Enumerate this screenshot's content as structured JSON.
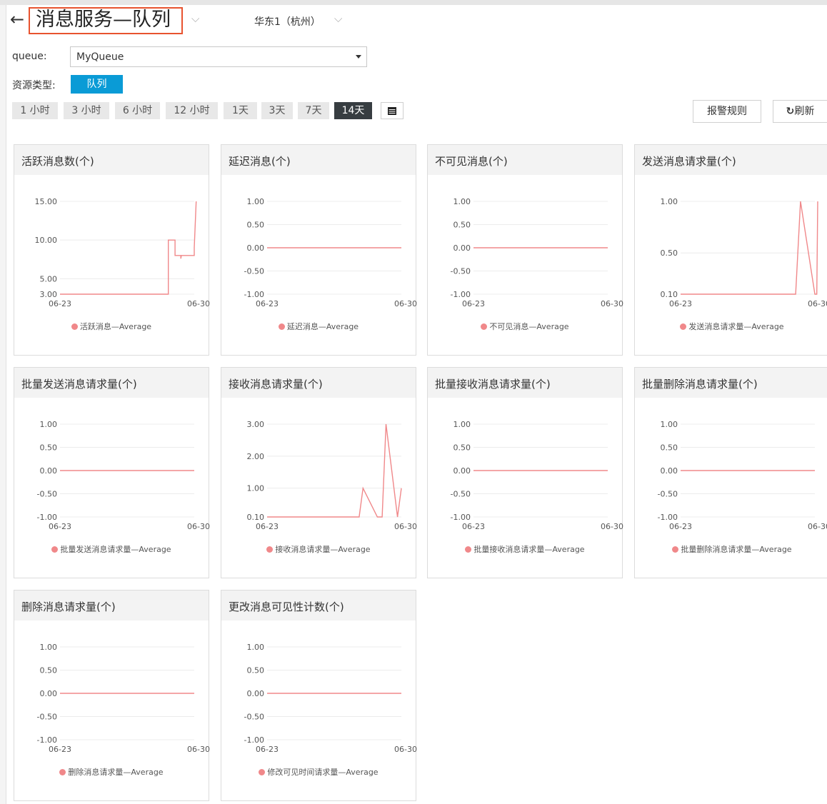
{
  "header": {
    "back_icon": "arrow-left-icon",
    "title": "消息服务—队列",
    "region": "华东1（杭州）"
  },
  "filters": {
    "queue_label": "queue:",
    "queue_value": "MyQueue",
    "resource_type_label": "资源类型:",
    "resource_type_value": "队列"
  },
  "time_ranges": [
    "1 小时",
    "3 小时",
    "6 小时",
    "12 小时",
    "1天",
    "3天",
    "7天",
    "14天"
  ],
  "active_range": "14天",
  "buttons": {
    "alarm_rules": "报警规则",
    "refresh": "刷新",
    "refresh_icon": "refresh-icon",
    "calendar_icon": "calendar-icon"
  },
  "colors": {
    "accent": "#0a9bd6",
    "series": "#f0888a",
    "title_highlight": "#e8532f",
    "active_range": "#373d41"
  },
  "chart_data": [
    {
      "type": "line",
      "title": "活跃消息数(个)",
      "yticks": [
        "15.00",
        "10.00",
        "5.00",
        "3.00"
      ],
      "ylim": [
        3,
        15
      ],
      "x_labels": [
        "06-23",
        "06-30"
      ],
      "xlim": [
        0,
        14
      ],
      "series": [
        {
          "name": "活跃消息—Average",
          "points": [
            [
              0,
              3
            ],
            [
              11.3,
              3
            ],
            [
              11.3,
              10
            ],
            [
              12,
              10
            ],
            [
              12,
              8
            ],
            [
              12.6,
              8
            ],
            [
              12.6,
              7.6
            ],
            [
              12.65,
              8
            ],
            [
              14,
              8
            ],
            [
              14,
              9
            ],
            [
              14.2,
              15
            ]
          ]
        }
      ]
    },
    {
      "type": "line",
      "title": "延迟消息(个)",
      "yticks": [
        "1.00",
        "0.50",
        "0.00",
        "-0.50",
        "-1.00"
      ],
      "ylim": [
        -1,
        1
      ],
      "x_labels": [
        "06-23",
        "06-30"
      ],
      "xlim": [
        0,
        14
      ],
      "series": [
        {
          "name": "延迟消息—Average",
          "points": [
            [
              0,
              0
            ],
            [
              14,
              0
            ]
          ]
        }
      ]
    },
    {
      "type": "line",
      "title": "不可见消息(个)",
      "yticks": [
        "1.00",
        "0.50",
        "0.00",
        "-0.50",
        "-1.00"
      ],
      "ylim": [
        -1,
        1
      ],
      "x_labels": [
        "06-23",
        "06-30"
      ],
      "xlim": [
        0,
        14
      ],
      "series": [
        {
          "name": "不可见消息—Average",
          "points": [
            [
              0,
              0
            ],
            [
              14,
              0
            ]
          ]
        }
      ]
    },
    {
      "type": "line",
      "title": "发送消息请求量(个)",
      "yticks": [
        "1.00",
        "0.50",
        "0.10"
      ],
      "ylim": [
        0.1,
        1
      ],
      "x_labels": [
        "06-23",
        "06-30"
      ],
      "xlim": [
        0,
        14
      ],
      "series": [
        {
          "name": "发送消息请求量—Average",
          "points": [
            [
              0,
              0.1
            ],
            [
              12,
              0.1
            ],
            [
              12.5,
              1
            ],
            [
              14,
              0.1
            ],
            [
              14.2,
              0.1
            ],
            [
              14.3,
              1
            ]
          ]
        }
      ]
    },
    {
      "type": "line",
      "title": "批量发送消息请求量(个)",
      "yticks": [
        "1.00",
        "0.50",
        "0.00",
        "-0.50",
        "-1.00"
      ],
      "ylim": [
        -1,
        1
      ],
      "x_labels": [
        "06-23",
        "06-30"
      ],
      "xlim": [
        0,
        14
      ],
      "series": [
        {
          "name": "批量发送消息请求量—Average",
          "points": [
            [
              0,
              0
            ],
            [
              14,
              0
            ]
          ]
        }
      ]
    },
    {
      "type": "line",
      "title": "接收消息请求量(个)",
      "yticks": [
        "3.00",
        "2.00",
        "1.00",
        "0.10"
      ],
      "ylim": [
        0.1,
        3
      ],
      "x_labels": [
        "06-23",
        "06-30"
      ],
      "xlim": [
        0,
        14
      ],
      "series": [
        {
          "name": "接收消息请求量—Average",
          "points": [
            [
              0,
              0.1
            ],
            [
              9.6,
              0.1
            ],
            [
              10,
              1
            ],
            [
              11.5,
              0.1
            ],
            [
              12,
              0.1
            ],
            [
              12.4,
              3
            ],
            [
              13.6,
              0.1
            ],
            [
              14,
              1
            ]
          ]
        }
      ]
    },
    {
      "type": "line",
      "title": "批量接收消息请求量(个)",
      "yticks": [
        "1.00",
        "0.50",
        "0.00",
        "-0.50",
        "-1.00"
      ],
      "ylim": [
        -1,
        1
      ],
      "x_labels": [
        "06-23",
        "06-30"
      ],
      "xlim": [
        0,
        14
      ],
      "series": [
        {
          "name": "批量接收消息请求量—Average",
          "points": [
            [
              0,
              0
            ],
            [
              14,
              0
            ]
          ]
        }
      ]
    },
    {
      "type": "line",
      "title": "批量删除消息请求量(个)",
      "yticks": [
        "1.00",
        "0.50",
        "0.00",
        "-0.50",
        "-1.00"
      ],
      "ylim": [
        -1,
        1
      ],
      "x_labels": [
        "06-23",
        "06-30"
      ],
      "xlim": [
        0,
        14
      ],
      "series": [
        {
          "name": "批量删除消息请求量—Average",
          "points": [
            [
              0,
              0
            ],
            [
              14,
              0
            ]
          ]
        }
      ]
    },
    {
      "type": "line",
      "title": "删除消息请求量(个)",
      "yticks": [
        "1.00",
        "0.50",
        "0.00",
        "-0.50",
        "-1.00"
      ],
      "ylim": [
        -1,
        1
      ],
      "x_labels": [
        "06-23",
        "06-30"
      ],
      "xlim": [
        0,
        14
      ],
      "series": [
        {
          "name": "删除消息请求量—Average",
          "points": [
            [
              0,
              0
            ],
            [
              14,
              0
            ]
          ]
        }
      ]
    },
    {
      "type": "line",
      "title": "更改消息可见性计数(个)",
      "yticks": [
        "1.00",
        "0.50",
        "0.00",
        "-0.50",
        "-1.00"
      ],
      "ylim": [
        -1,
        1
      ],
      "x_labels": [
        "06-23",
        "06-30"
      ],
      "xlim": [
        0,
        14
      ],
      "series": [
        {
          "name": "修改可见时间请求量—Average",
          "points": [
            [
              0,
              0
            ],
            [
              14,
              0
            ]
          ]
        }
      ]
    }
  ]
}
